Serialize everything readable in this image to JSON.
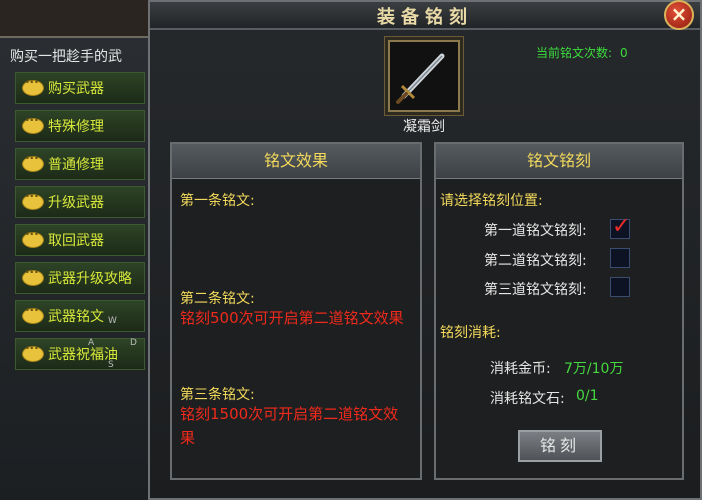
{
  "left": {
    "dialog": "购买一把趁手的武",
    "menu": [
      "购买武器",
      "特殊修理",
      "普通修理",
      "升级武器",
      "取回武器",
      "武器升级攻略",
      "武器铭文",
      "武器祝福油"
    ],
    "wasd": [
      "W",
      "A",
      "S",
      "D"
    ]
  },
  "window": {
    "title": "装备铭刻",
    "close": "×",
    "counter_label": "当前铭文次数:",
    "counter_value": "0",
    "item_name": "凝霜剑"
  },
  "effect_box": {
    "header": "铭文效果",
    "slot1_label": "第一条铭文:",
    "slot2_label": "第二条铭文:",
    "slot2_text": "铭刻500次可开启第二道铭文效果",
    "slot3_label": "第三条铭文:",
    "slot3_text": "铭刻1500次可开启第二道铭文效果"
  },
  "engrave_box": {
    "header": "铭文铭刻",
    "prompt": "请选择铭刻位置:",
    "options": [
      {
        "label": "第一道铭文铭刻:",
        "checked": true
      },
      {
        "label": "第二道铭文铭刻:",
        "checked": false
      },
      {
        "label": "第三道铭文铭刻:",
        "checked": false
      }
    ],
    "cost_title": "铭刻消耗:",
    "gold_label": "消耗金币:",
    "gold_value": "7万/10万",
    "stone_label": "消耗铭文石:",
    "stone_value": "0/1",
    "button": "铭刻"
  },
  "colors": {
    "accent_yellow": "#f2d95b",
    "red_text": "#f02a1c",
    "green_text": "#45d83f"
  }
}
